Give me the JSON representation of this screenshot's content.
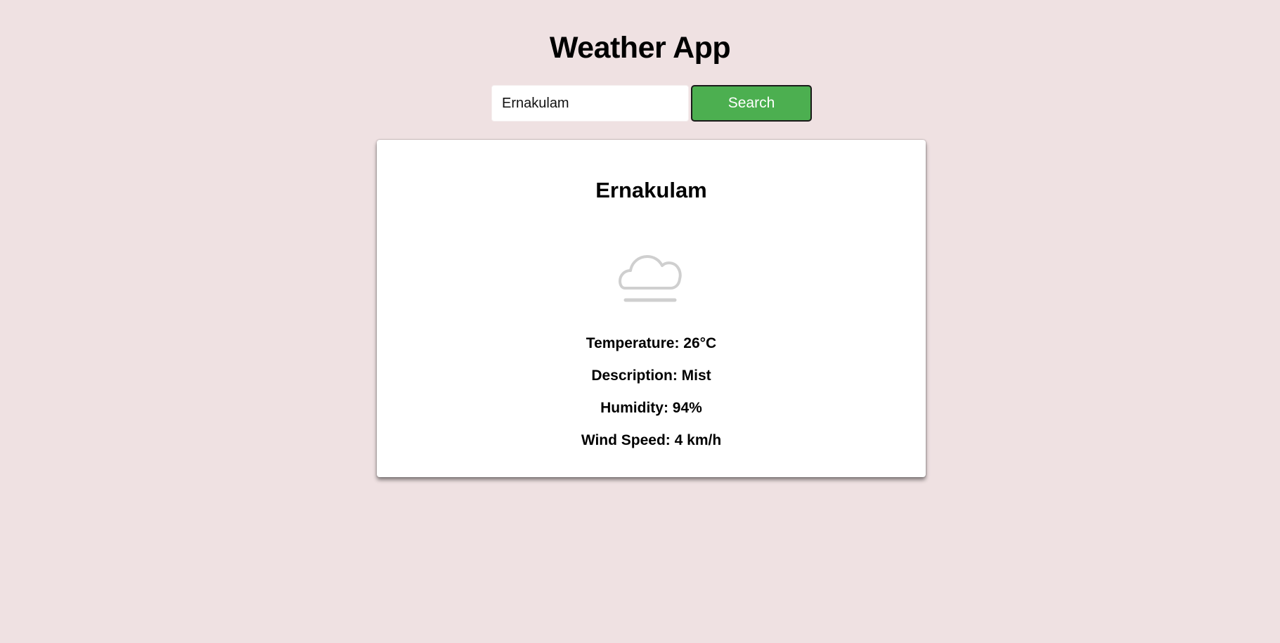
{
  "header": {
    "title": "Weather App"
  },
  "search": {
    "value": "Ernakulam",
    "button_label": "Search"
  },
  "weather": {
    "city": "Ernakulam",
    "icon": "mist-cloud-icon",
    "temperature": "Temperature: 26°C",
    "description": "Description: Mist",
    "humidity": "Humidity: 94%",
    "wind_speed": "Wind Speed: 4 km/h"
  },
  "colors": {
    "background": "#efe1e2",
    "button": "#4caf50",
    "card": "#ffffff",
    "icon": "#cfcfcf"
  }
}
